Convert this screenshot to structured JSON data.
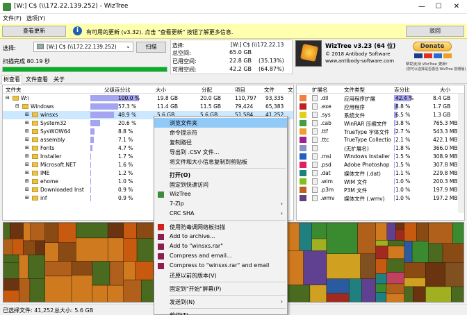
{
  "window": {
    "title": "[W:] C$ (\\\\172.22.139.252) - WizTree",
    "min": "—",
    "max": "☐",
    "close": "✕"
  },
  "menu": [
    "文件(F)",
    "选项(Y)"
  ],
  "info": {
    "scan_btn": "查看更新",
    "message": "有可用的更新 (v3.32). 点击 \"查看更新\" 按钮了解更多信息.",
    "close_btn": "驳回"
  },
  "left": {
    "select_label": "选择:",
    "drive_value": "[W:] C$ (\\\\172.22.139.252)",
    "scan_button": "扫描",
    "status": "扫描完成 80.19 秒",
    "progress": 1.0
  },
  "stats": {
    "select_label": "选择:",
    "drive": "[W:] C$ (\\\\172.22.13",
    "rows": [
      [
        "总空间:",
        "65.0 GB",
        ""
      ],
      [
        "已用空间:",
        "22.8 GB",
        "(35.13%)"
      ],
      [
        "可用空间:",
        "42.2 GB",
        "(64.87%)"
      ]
    ]
  },
  "about": {
    "product": "WizTree v3.23 (64 位)",
    "copyright": "© 2018 Antibody Software",
    "url": "www.antibody-software.com",
    "donate": "Donate",
    "donate_note": "帮助支持 WizTree 更新!",
    "donate_note2": "(您可以选择是否激活 WizTree 捐赠版)"
  },
  "tabs": [
    "树查看",
    "文件查看",
    "关于"
  ],
  "tree": {
    "headers": [
      "文件夹",
      "父级百分比",
      "大小",
      "分配",
      "项目",
      "文件",
      "文"
    ],
    "rows": [
      {
        "name": "W:\\",
        "pct": "100.0 %",
        "pv": 1.0,
        "size": "19.8 GB",
        "alloc": "20.0 GB",
        "items": "110,797",
        "files": "93,335",
        "indent": 1
      },
      {
        "name": "Windows",
        "pct": "57.3 %",
        "pv": 0.573,
        "size": "11.4 GB",
        "alloc": "11.5 GB",
        "items": "79,424",
        "files": "65,383",
        "indent": 2
      },
      {
        "name": "winsxs",
        "pct": "48.9 %",
        "pv": 0.489,
        "size": "5.6 GB",
        "alloc": "5.6 GB",
        "items": "51,584",
        "files": "41,252",
        "indent": 3
      },
      {
        "name": "System32",
        "pct": "20.6 %",
        "pv": 0.206,
        "size": "",
        "alloc": "",
        "items": "",
        "files": "",
        "indent": 3
      },
      {
        "name": "SysWOW64",
        "pct": "8.8 %",
        "pv": 0.088,
        "size": "",
        "alloc": "",
        "items": "",
        "files": "",
        "indent": 3
      },
      {
        "name": "assembly",
        "pct": "7.1 %",
        "pv": 0.071,
        "size": "",
        "alloc": "",
        "items": "",
        "files": "",
        "indent": 3
      },
      {
        "name": "Fonts",
        "pct": "4.7 %",
        "pv": 0.047,
        "size": "",
        "alloc": "",
        "items": "",
        "files": "",
        "indent": 3
      },
      {
        "name": "Installer",
        "pct": "1.7 %",
        "pv": 0.017,
        "size": "",
        "alloc": "",
        "items": "",
        "files": "",
        "indent": 3
      },
      {
        "name": "Microsoft.NET",
        "pct": "1.6 %",
        "pv": 0.016,
        "size": "",
        "alloc": "",
        "items": "",
        "files": "",
        "indent": 3
      },
      {
        "name": "IME",
        "pct": "1.2 %",
        "pv": 0.012,
        "size": "",
        "alloc": "",
        "items": "",
        "files": "",
        "indent": 3
      },
      {
        "name": "ehome",
        "pct": "1.0 %",
        "pv": 0.01,
        "size": "",
        "alloc": "",
        "items": "",
        "files": "",
        "indent": 3
      },
      {
        "name": "Downloaded Inst",
        "pct": "0.9 %",
        "pv": 0.009,
        "size": "",
        "alloc": "",
        "items": "",
        "files": "",
        "indent": 3
      },
      {
        "name": "inf",
        "pct": "0.9 %",
        "pv": 0.009,
        "size": "",
        "alloc": "",
        "items": "",
        "files": "",
        "indent": 3
      }
    ]
  },
  "types": {
    "headers": [
      "扩展名",
      "文件类型",
      "百分比",
      "大小"
    ],
    "rows": [
      {
        "ext": ".dll",
        "type": "应用程序扩展",
        "pct": "42.4 %",
        "pv": 0.424,
        "size": "8.4 GB",
        "color": "#f08040"
      },
      {
        "ext": ".exe",
        "type": "应用程序",
        "pct": "8.8 %",
        "pv": 0.088,
        "size": "1.7 GB",
        "color": "#c02020"
      },
      {
        "ext": ".sys",
        "type": "系统文件",
        "pct": "6.5 %",
        "pv": 0.065,
        "size": "1.3 GB",
        "color": "#e0d020"
      },
      {
        "ext": ".cab",
        "type": "WinRAR 压缩文件",
        "pct": "3.8 %",
        "pv": 0.038,
        "size": "765.3 MB",
        "color": "#40a040"
      },
      {
        "ext": ".ttf",
        "type": "TrueType 字体文件",
        "pct": "2.7 %",
        "pv": 0.027,
        "size": "543.3 MB",
        "color": "#f0a030"
      },
      {
        "ext": ".ttc",
        "type": "TrueType Collectio",
        "pct": "2.1 %",
        "pv": 0.021,
        "size": "422.1 MB",
        "color": "#a02090"
      },
      {
        "ext": "",
        "type": "(无扩展名)",
        "pct": "1.8 %",
        "pv": 0.018,
        "size": "366.0 MB",
        "color": "#9090c0"
      },
      {
        "ext": ".msi",
        "type": "Windows Installer",
        "pct": "1.5 %",
        "pv": 0.015,
        "size": "308.9 MB",
        "color": "#2060c0"
      },
      {
        "ext": ".psd",
        "type": "Adobe Photoshop",
        "pct": "1.5 %",
        "pv": 0.015,
        "size": "307.8 MB",
        "color": "#e02060"
      },
      {
        "ext": ".dat",
        "type": "媒体文件 (.dat)",
        "pct": "1.1 %",
        "pv": 0.011,
        "size": "229.8 MB",
        "color": "#208080"
      },
      {
        "ext": ".wim",
        "type": "WIM 文件",
        "pct": "1.0 %",
        "pv": 0.01,
        "size": "200.3 MB",
        "color": "#80c020"
      },
      {
        "ext": ".p3m",
        "type": "P3M 文件",
        "pct": "1.0 %",
        "pv": 0.01,
        "size": "197.9 MB",
        "color": "#c06020"
      },
      {
        "ext": ".wmv",
        "type": "媒体文件 (.wmv)",
        "pct": "1.0 %",
        "pv": 0.01,
        "size": "197.2 MB",
        "color": "#604080"
      }
    ]
  },
  "context_menu": [
    {
      "label": "浏览文件夹",
      "highlight": true
    },
    {
      "label": "命令提示符"
    },
    {
      "label": "复制路径"
    },
    {
      "label": "导出到 .CSV 文件..."
    },
    {
      "label": "将文件和大小信息复制到剪贴板"
    },
    {
      "sep": true
    },
    {
      "label": "打开(O)",
      "bold": true
    },
    {
      "label": "固定到快速访问"
    },
    {
      "label": "WizTree",
      "icon": "#3c8c3c"
    },
    {
      "label": "7-Zip",
      "arrow": true
    },
    {
      "label": "CRC SHA",
      "arrow": true
    },
    {
      "sep": true
    },
    {
      "label": "使用防毒调网络板扫描",
      "icon": "#d02020"
    },
    {
      "label": "Add to archive...",
      "icon": "#8b2050"
    },
    {
      "label": "Add to \"winsxs.rar\"",
      "icon": "#8b2050"
    },
    {
      "label": "Compress and email...",
      "icon": "#8b2050"
    },
    {
      "label": "Compress to \"winsxs.rar\" and email",
      "icon": "#8b2050"
    },
    {
      "label": "还原以前的版本(V)"
    },
    {
      "sep": true
    },
    {
      "label": "固定到\"开始\"屏幕(P)"
    },
    {
      "sep": true
    },
    {
      "label": "发送到(N)",
      "arrow": true
    },
    {
      "sep": true
    },
    {
      "label": "剪切(T)"
    }
  ],
  "status": {
    "selected": "已选择文件: 41,252",
    "total": "总大小: 5.6 GB"
  }
}
